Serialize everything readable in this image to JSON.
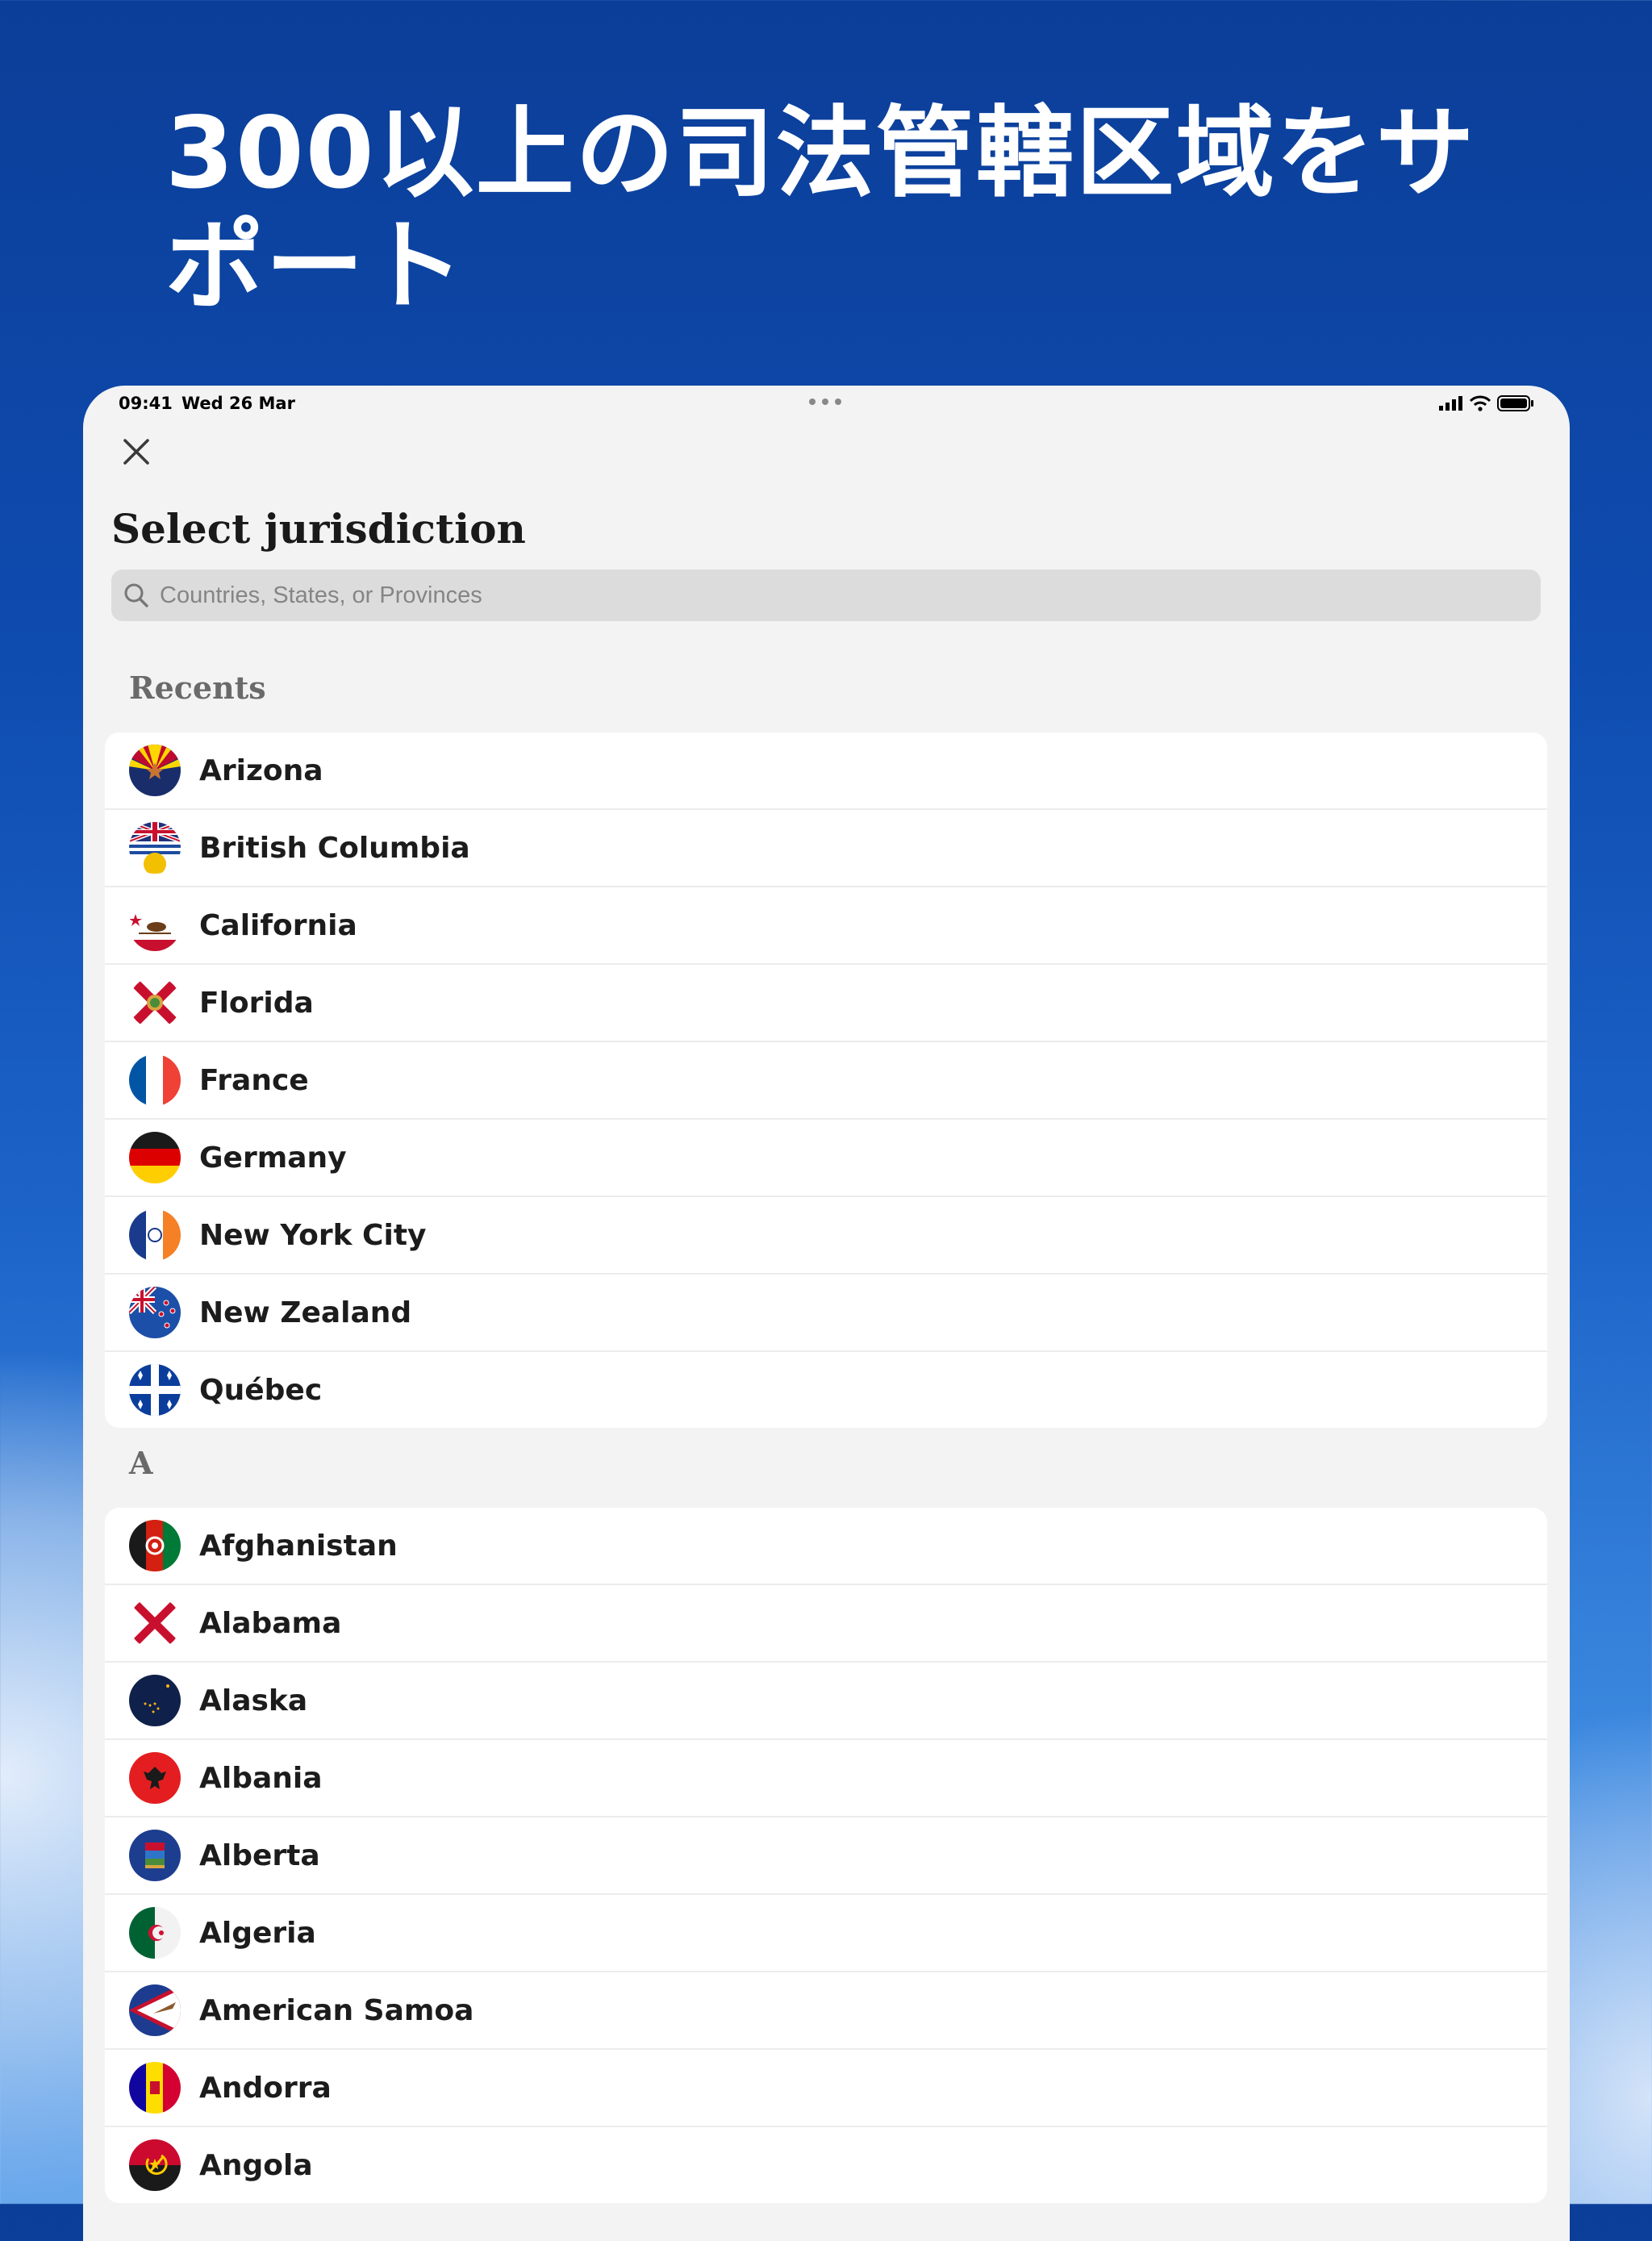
{
  "headline": "300以上の司法管轄区域をサポート",
  "status": {
    "time": "09:41",
    "date": "Wed 26 Mar"
  },
  "screen_title": "Select jurisdiction",
  "search": {
    "placeholder": "Countries, States, or Provinces"
  },
  "recents": {
    "label": "Recents",
    "items": [
      {
        "name": "Arizona",
        "icon": "arizona-flag-icon"
      },
      {
        "name": "British Columbia",
        "icon": "british-columbia-flag-icon"
      },
      {
        "name": "California",
        "icon": "california-flag-icon"
      },
      {
        "name": "Florida",
        "icon": "florida-flag-icon"
      },
      {
        "name": "France",
        "icon": "france-flag-icon"
      },
      {
        "name": "Germany",
        "icon": "germany-flag-icon"
      },
      {
        "name": "New York City",
        "icon": "new-york-city-flag-icon"
      },
      {
        "name": "New Zealand",
        "icon": "new-zealand-flag-icon"
      },
      {
        "name": "Québec",
        "icon": "quebec-flag-icon"
      }
    ]
  },
  "section_a": {
    "label": "A",
    "items": [
      {
        "name": "Afghanistan",
        "icon": "afghanistan-flag-icon"
      },
      {
        "name": "Alabama",
        "icon": "alabama-flag-icon"
      },
      {
        "name": "Alaska",
        "icon": "alaska-flag-icon"
      },
      {
        "name": "Albania",
        "icon": "albania-flag-icon"
      },
      {
        "name": "Alberta",
        "icon": "alberta-flag-icon"
      },
      {
        "name": "Algeria",
        "icon": "algeria-flag-icon"
      },
      {
        "name": "American Samoa",
        "icon": "american-samoa-flag-icon"
      },
      {
        "name": "Andorra",
        "icon": "andorra-flag-icon"
      },
      {
        "name": "Angola",
        "icon": "angola-flag-icon"
      }
    ]
  },
  "colors": {
    "background": "#0f4cb0",
    "sheet": "#f3f3f3",
    "row": "#ffffff"
  }
}
